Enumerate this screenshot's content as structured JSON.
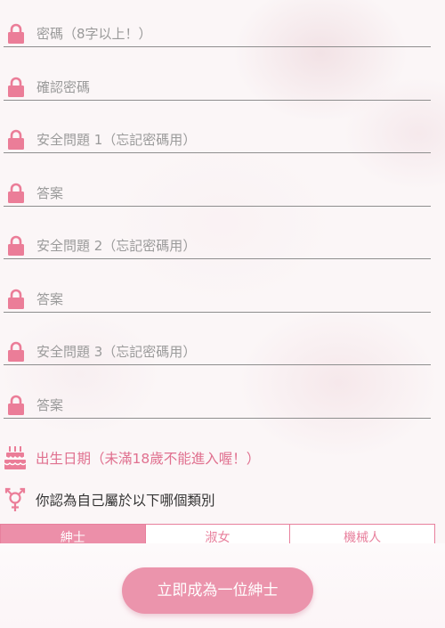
{
  "form": {
    "fields": [
      {
        "placeholder": "密碼（8字以上！）"
      },
      {
        "placeholder": "確認密碼"
      },
      {
        "placeholder": "安全問題 1（忘記密碼用）"
      },
      {
        "placeholder": "答案"
      },
      {
        "placeholder": "安全問題 2（忘記密碼用）"
      },
      {
        "placeholder": "答案"
      },
      {
        "placeholder": "安全問題 3（忘記密碼用）"
      },
      {
        "placeholder": "答案"
      }
    ],
    "birthday_label": "出生日期（未滿18歲不能進入喔！）",
    "gender_prompt": "你認為自己屬於以下哪個類別",
    "gender_options": [
      {
        "label": "紳士",
        "selected": true
      },
      {
        "label": "淑女",
        "selected": false
      },
      {
        "label": "機械人",
        "selected": false
      }
    ]
  },
  "submit_label": "立即成為一位紳士",
  "colors": {
    "accent": "#ec8fa9",
    "lock": "#eb7d98",
    "birthday": "#e0708f"
  },
  "icons": {
    "field": "lock-icon",
    "birthday": "cake-icon",
    "gender": "gender-icon"
  }
}
